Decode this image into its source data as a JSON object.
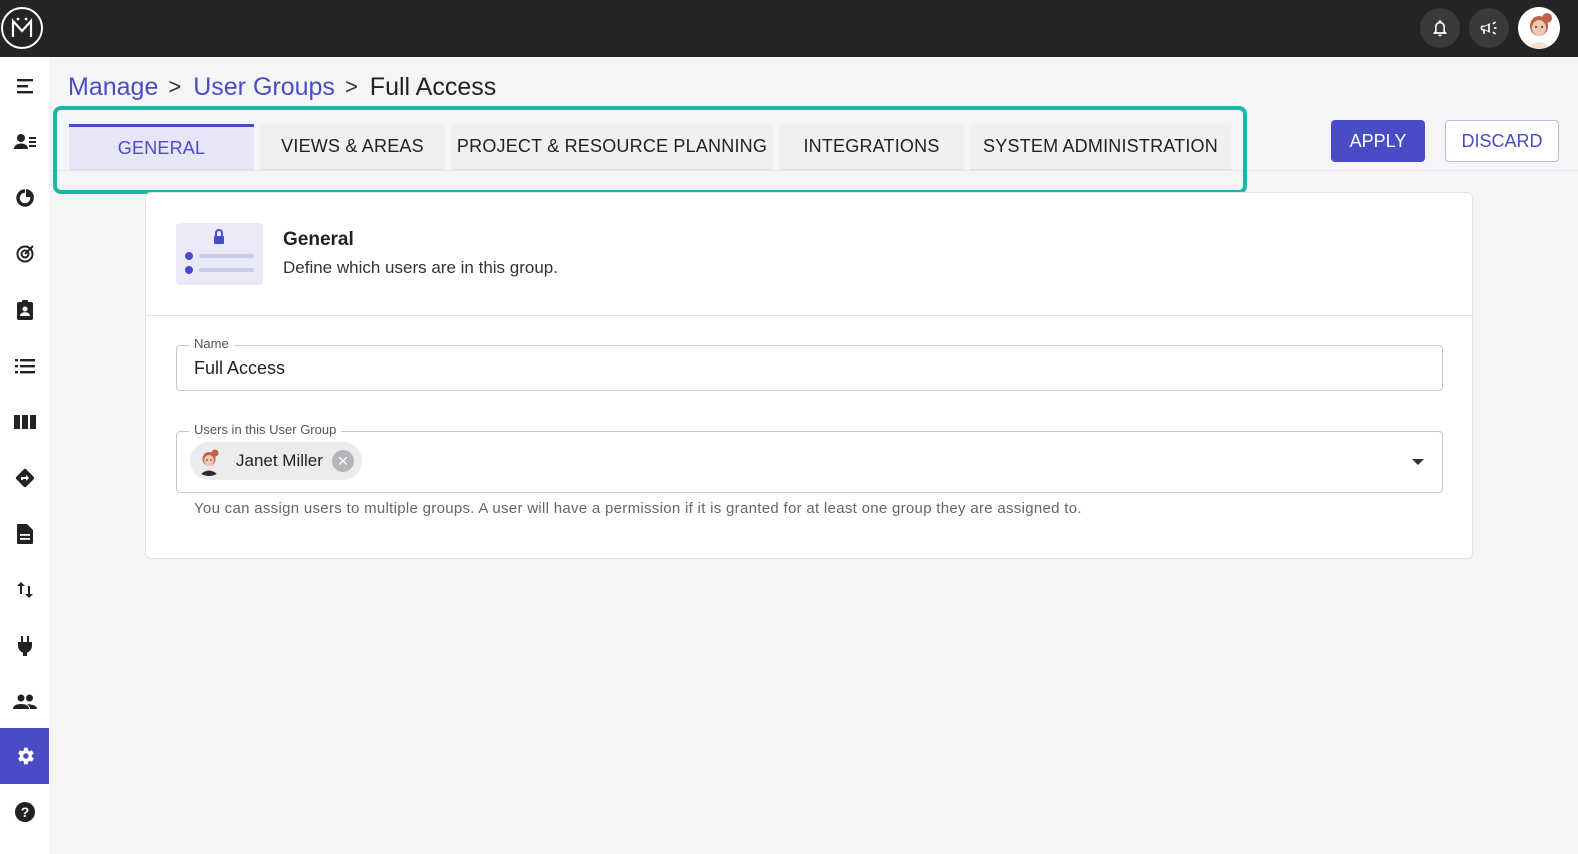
{
  "breadcrumb": {
    "manage": "Manage",
    "user_groups": "User Groups",
    "current": "Full Access",
    "separator": ">"
  },
  "tabs": [
    {
      "label": "GENERAL",
      "active": true
    },
    {
      "label": "VIEWS & AREAS",
      "active": false
    },
    {
      "label": "PROJECT & RESOURCE PLANNING",
      "active": false
    },
    {
      "label": "INTEGRATIONS",
      "active": false
    },
    {
      "label": "SYSTEM ADMINISTRATION",
      "active": false
    }
  ],
  "actions": {
    "apply": "APPLY",
    "discard": "DISCARD"
  },
  "topbar": {
    "icons": [
      "app-logo-icon",
      "bell-icon",
      "megaphone-icon",
      "user-avatar"
    ]
  },
  "sidebar": {
    "icons": [
      "menu-collapse-icon",
      "user-list-icon",
      "pie-chart-icon",
      "target-icon",
      "clipboard-user-icon",
      "list-icon",
      "columns-icon",
      "directions-icon",
      "document-icon",
      "import-export-icon",
      "plug-icon",
      "people-icon",
      "settings-icon",
      "help-icon"
    ],
    "active": "settings-icon"
  },
  "section": {
    "title": "General",
    "subtitle": "Define which users are in this group."
  },
  "form": {
    "name_label": "Name",
    "name_value": "Full Access",
    "users_label": "Users in this User Group",
    "users": [
      "Janet Miller"
    ],
    "helper_text": "You can assign users to multiple groups. A user will have a permission if it is granted for at least one group they are assigned to."
  },
  "colors": {
    "accent": "#4a4cc6",
    "highlight": "#1cb5a7",
    "topbar": "#242424"
  }
}
